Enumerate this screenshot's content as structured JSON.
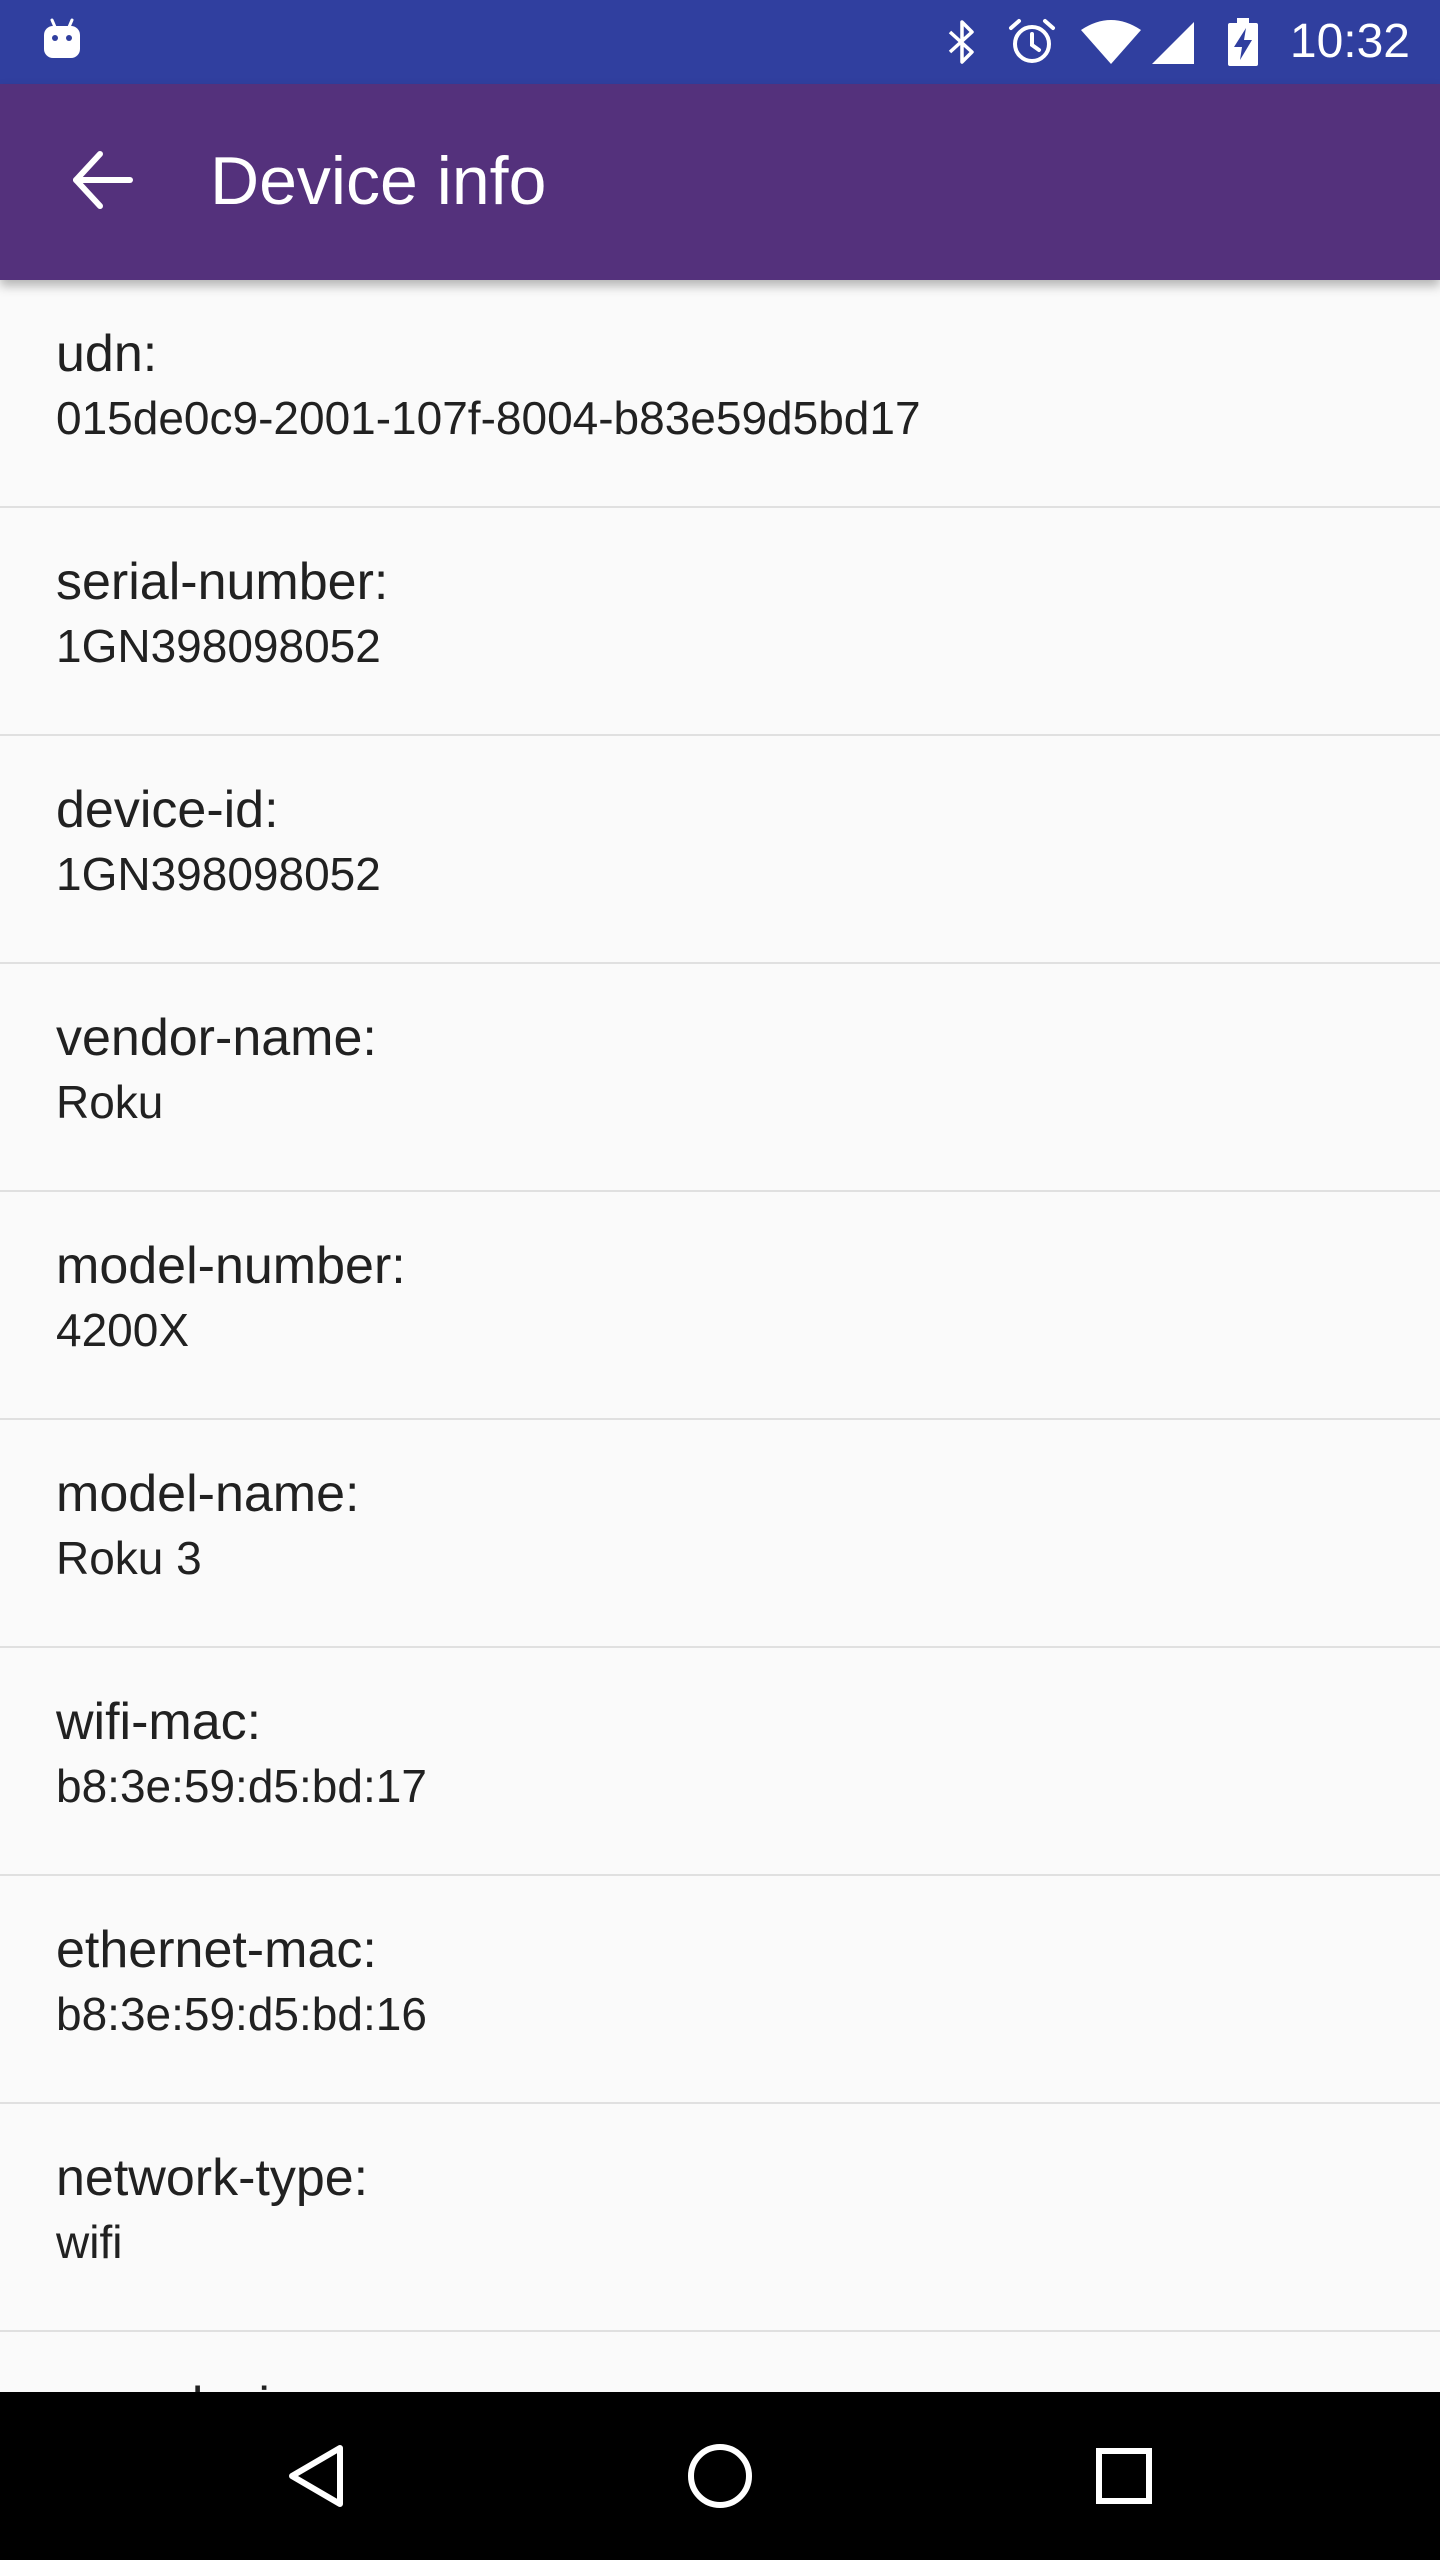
{
  "status_bar": {
    "time": "10:32",
    "icons": [
      "android-notification-icon",
      "bluetooth-icon",
      "alarm-icon",
      "wifi-icon",
      "cell-signal-icon",
      "battery-charging-icon"
    ]
  },
  "app_bar": {
    "title": "Device info",
    "back_icon": "arrow-back-icon"
  },
  "items": [
    {
      "label": "udn:",
      "value": "015de0c9-2001-107f-8004-b83e59d5bd17"
    },
    {
      "label": "serial-number:",
      "value": "1GN398098052"
    },
    {
      "label": "device-id:",
      "value": "1GN398098052"
    },
    {
      "label": "vendor-name:",
      "value": "Roku"
    },
    {
      "label": "model-number:",
      "value": "4200X"
    },
    {
      "label": "model-name:",
      "value": "Roku 3"
    },
    {
      "label": "wifi-mac:",
      "value": "b8:3e:59:d5:bd:17"
    },
    {
      "label": "ethernet-mac:",
      "value": "b8:3e:59:d5:bd:16"
    },
    {
      "label": "network-type:",
      "value": "wifi"
    },
    {
      "label": "user-device-name:",
      "value": ""
    }
  ],
  "nav_bar": {
    "icons": [
      "back-triangle-icon",
      "home-circle-icon",
      "recents-square-icon"
    ]
  },
  "colors": {
    "status_bar": "#303f9f",
    "app_bar": "#54317c",
    "background": "#fafafa",
    "divider": "#e0e0e0",
    "nav_bar": "#000000"
  }
}
